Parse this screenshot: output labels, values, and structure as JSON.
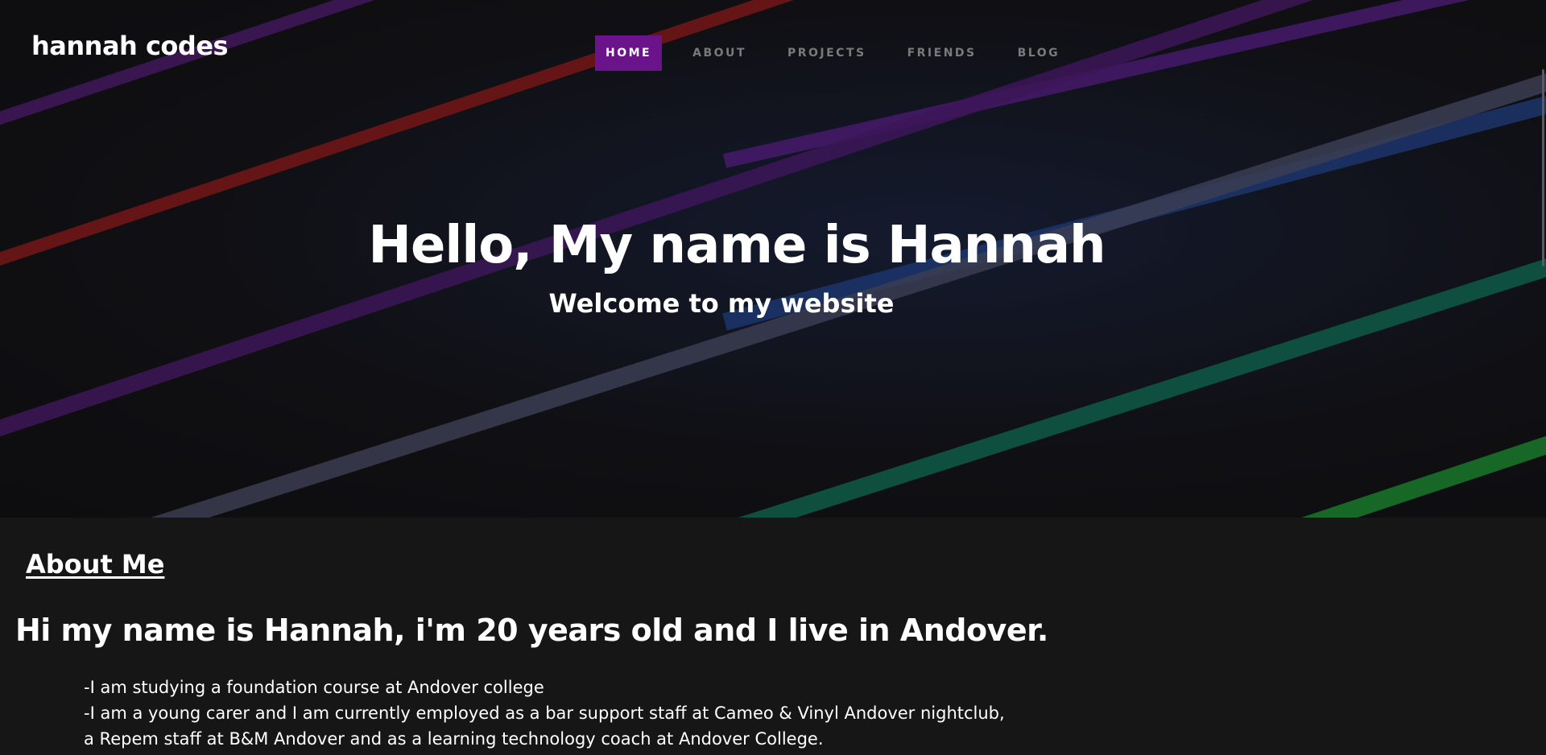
{
  "brand": {
    "title": "hannah codes"
  },
  "nav": {
    "items": [
      {
        "label": "HOME",
        "active": true
      },
      {
        "label": "ABOUT",
        "active": false
      },
      {
        "label": "PROJECTS",
        "active": false
      },
      {
        "label": "FRIENDS",
        "active": false
      },
      {
        "label": "BLOG",
        "active": false
      }
    ],
    "active_color": "#6a138a"
  },
  "hero": {
    "title": "Hello, My name is Hannah",
    "subtitle": "Welcome to my website",
    "stripe_colors": [
      "#5a1f7a",
      "#8a1a1a",
      "#4a1a6e",
      "#1e3a7a",
      "#2c2c44",
      "#0f6a4a",
      "#1a7a2a"
    ]
  },
  "about": {
    "heading": "About Me",
    "intro": "Hi my name is Hannah, i'm 20 years old and I live in Andover.",
    "lines": [
      "-I am studying a foundation course at Andover college",
      "-I am a young carer and I am currently employed as a bar support staff at Cameo & Vinyl Andover nightclub,",
      "a Repem staff at B&M Andover and as a learning technology coach at Andover College."
    ]
  }
}
